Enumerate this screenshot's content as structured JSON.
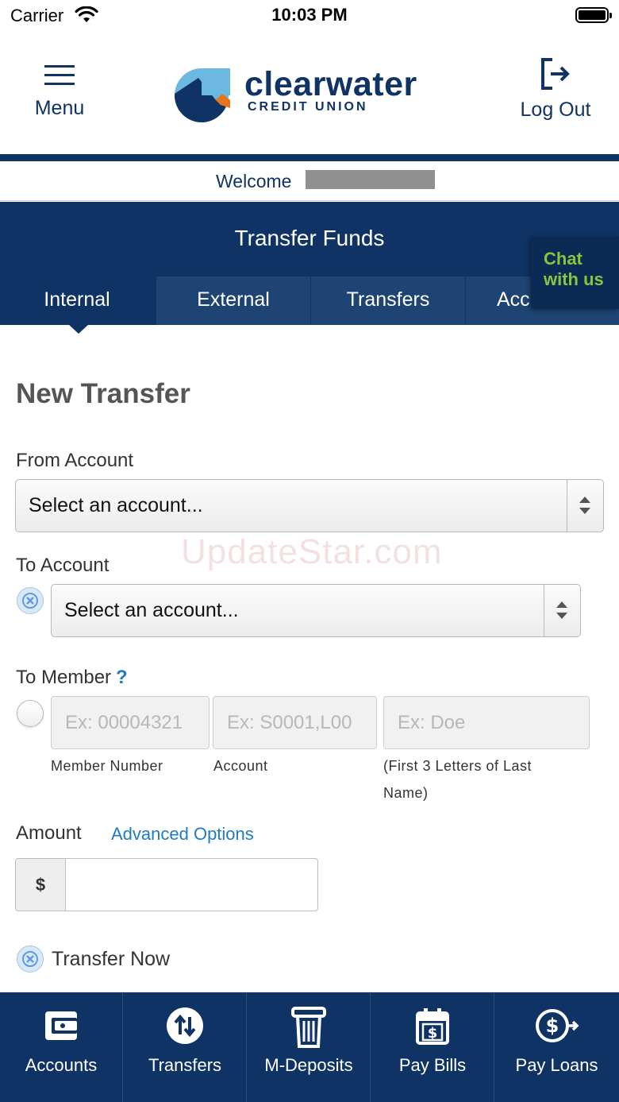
{
  "status_bar": {
    "carrier": "Carrier",
    "time": "10:03 PM"
  },
  "header": {
    "menu_label": "Menu",
    "logo_name": "clearwater",
    "logo_sub": "CREDIT UNION",
    "logout_label": "Log Out",
    "brand_color": "#0f3365"
  },
  "welcome": {
    "text": "Welcome"
  },
  "transfer": {
    "title": "Transfer Funds",
    "tabs": [
      {
        "label": "Internal"
      },
      {
        "label": "External"
      },
      {
        "label": "Transfers"
      },
      {
        "label": "Acc"
      }
    ],
    "chat_label_line1": "Chat",
    "chat_label_line2": "with us"
  },
  "form": {
    "title": "New Transfer",
    "from_label": "From Account",
    "from_selected": "Select an account...",
    "to_label": "To Account",
    "to_selected": "Select an account...",
    "to_member_label": "To Member",
    "help_mark": "?",
    "member_number_placeholder": "Ex: 00004321",
    "account_placeholder": "Ex: S0001,L00",
    "last_name_placeholder": "Ex: Doe",
    "member_number_hint": "Member Number",
    "account_hint": "Account",
    "last_name_hint_line1": "(First  3  Letters of Last",
    "last_name_hint_line2": "Name)",
    "amount_label": "Amount",
    "advanced_options": "Advanced Options",
    "currency_symbol": "$",
    "amount_value": "",
    "transfer_now_label": "Transfer Now"
  },
  "watermark": "UpdateStar.com",
  "bottom_nav": [
    {
      "label": "Accounts",
      "icon": "wallet-icon"
    },
    {
      "label": "Transfers",
      "icon": "transfer-arrows-icon"
    },
    {
      "label": "M-Deposits",
      "icon": "deposit-check-icon"
    },
    {
      "label": "Pay Bills",
      "icon": "calendar-dollar-icon"
    },
    {
      "label": "Pay Loans",
      "icon": "dollar-coin-arrow-icon"
    }
  ]
}
